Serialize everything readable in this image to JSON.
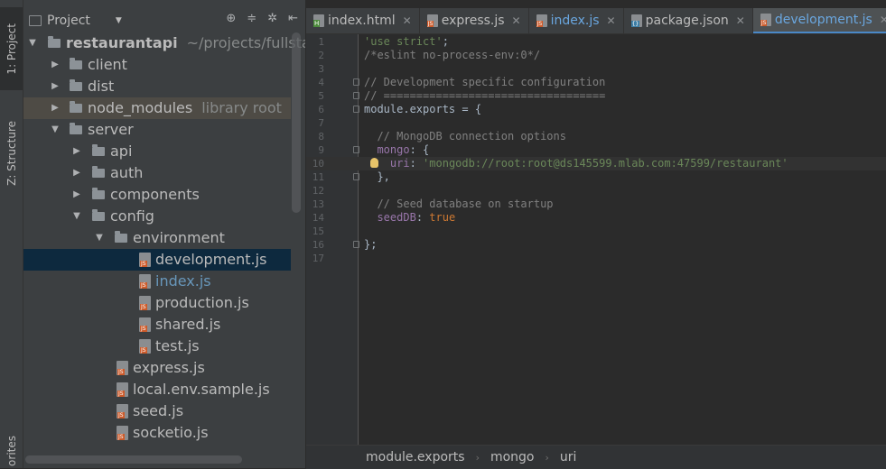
{
  "toolstrip": {
    "tabs": [
      {
        "label": "1: Project"
      },
      {
        "label": "Z: Structure"
      },
      {
        "label": "orites"
      }
    ]
  },
  "project_panel": {
    "title": "Project",
    "tree": [
      {
        "label": "restaurantapi",
        "note": "~/projects/fullstac",
        "kind": "folder",
        "depth": 0,
        "expanded": true
      },
      {
        "label": "client",
        "kind": "folder",
        "depth": 1,
        "expanded": false
      },
      {
        "label": "dist",
        "kind": "folder",
        "depth": 1,
        "expanded": false
      },
      {
        "label": "node_modules",
        "note": "library root",
        "kind": "folder",
        "depth": 1,
        "expanded": false
      },
      {
        "label": "server",
        "kind": "folder",
        "depth": 1,
        "expanded": true
      },
      {
        "label": "api",
        "kind": "folder",
        "depth": 2,
        "expanded": false
      },
      {
        "label": "auth",
        "kind": "folder",
        "depth": 2,
        "expanded": false
      },
      {
        "label": "components",
        "kind": "folder",
        "depth": 2,
        "expanded": false
      },
      {
        "label": "config",
        "kind": "folder",
        "depth": 2,
        "expanded": true
      },
      {
        "label": "environment",
        "kind": "folder",
        "depth": 3,
        "expanded": true
      },
      {
        "label": "development.js",
        "kind": "js",
        "depth": 4
      },
      {
        "label": "index.js",
        "kind": "js",
        "depth": 4
      },
      {
        "label": "production.js",
        "kind": "js",
        "depth": 4
      },
      {
        "label": "shared.js",
        "kind": "js",
        "depth": 4
      },
      {
        "label": "test.js",
        "kind": "js",
        "depth": 4
      },
      {
        "label": "express.js",
        "kind": "js",
        "depth": 3
      },
      {
        "label": "local.env.sample.js",
        "kind": "js",
        "depth": 3
      },
      {
        "label": "seed.js",
        "kind": "js",
        "depth": 3
      },
      {
        "label": "socketio.js",
        "kind": "js",
        "depth": 3
      }
    ]
  },
  "editor": {
    "tabs": [
      {
        "label": "index.html",
        "icon": "html-file-icon",
        "active": false
      },
      {
        "label": "express.js",
        "icon": "js-file-icon",
        "active": false
      },
      {
        "label": "index.js",
        "icon": "js-file-icon",
        "active": false
      },
      {
        "label": "package.json",
        "icon": "json-file-icon",
        "active": false
      },
      {
        "label": "development.js",
        "icon": "js-file-icon",
        "active": true
      }
    ],
    "line_numbers": [
      "1",
      "2",
      "3",
      "4",
      "5",
      "6",
      "7",
      "8",
      "9",
      "10",
      "11",
      "12",
      "13",
      "14",
      "15",
      "16",
      "17"
    ],
    "current_line": "10",
    "breadcrumb": [
      "module.exports",
      "mongo",
      "uri"
    ]
  },
  "colors": {
    "panel_bg": "#3c3f41",
    "editor_bg": "#2b2b2b",
    "selection": "#0d293e",
    "string": "#6a8759",
    "comment": "#808080",
    "keyword": "#cc7832",
    "property": "#9876aa"
  }
}
